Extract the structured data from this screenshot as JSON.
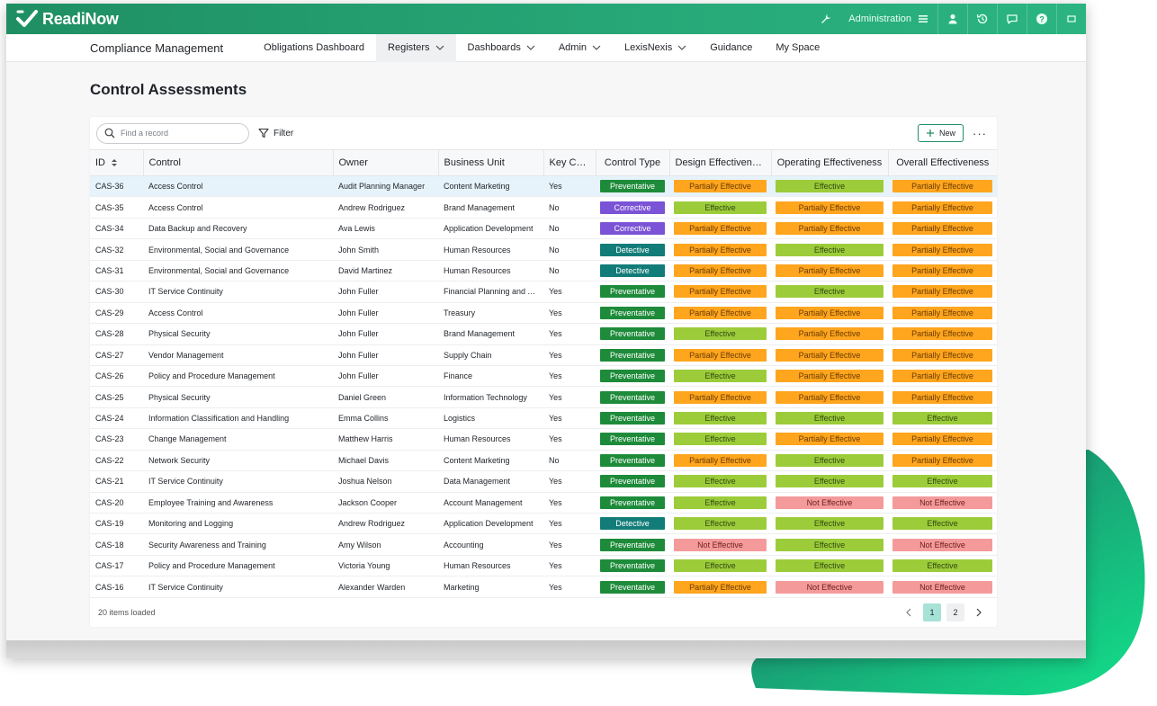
{
  "brand": {
    "name": "ReadiNow",
    "accent": "#27a878"
  },
  "topbar": {
    "administration_label": "Administration",
    "icons": [
      "wrench-icon",
      "hamburger-icon",
      "user-icon",
      "history-icon",
      "chat-icon",
      "help-icon",
      "fullscreen-icon"
    ]
  },
  "nav": {
    "app_title": "Compliance Management",
    "items": [
      {
        "label": "Obligations Dashboard",
        "dropdown": false
      },
      {
        "label": "Registers",
        "dropdown": true,
        "active": true
      },
      {
        "label": "Dashboards",
        "dropdown": true
      },
      {
        "label": "Admin",
        "dropdown": true
      },
      {
        "label": "LexisNexis",
        "dropdown": true
      },
      {
        "label": "Guidance",
        "dropdown": false
      },
      {
        "label": "My Space",
        "dropdown": false
      }
    ]
  },
  "page": {
    "title": "Control Assessments"
  },
  "toolbar": {
    "search_placeholder": "Find a record",
    "filter_label": "Filter",
    "new_label": "New",
    "more_label": "···"
  },
  "table": {
    "columns": [
      "ID",
      "Control",
      "Owner",
      "Business Unit",
      "Key Con...",
      "Control Type",
      "Design Effectiveness",
      "Operating Effectiveness",
      "Overall Effectiveness"
    ],
    "rows": [
      [
        "CAS-36",
        "Access Control",
        "Audit Planning Manager",
        "Content Marketing",
        "Yes",
        "Preventative",
        "Partially Effective",
        "Effective",
        "Partially Effective"
      ],
      [
        "CAS-35",
        "Access Control",
        "Andrew Rodriguez",
        "Brand Management",
        "No",
        "Corrective",
        "Effective",
        "Partially Effective",
        "Partially Effective"
      ],
      [
        "CAS-34",
        "Data Backup and Recovery",
        "Ava Lewis",
        "Application Development",
        "No",
        "Corrective",
        "Partially Effective",
        "Partially Effective",
        "Partially Effective"
      ],
      [
        "CAS-32",
        "Environmental, Social and Governance",
        "John Smith",
        "Human Resources",
        "No",
        "Detective",
        "Partially Effective",
        "Effective",
        "Partially Effective"
      ],
      [
        "CAS-31",
        "Environmental, Social and Governance",
        "David Martinez",
        "Human Resources",
        "No",
        "Detective",
        "Partially Effective",
        "Partially Effective",
        "Partially Effective"
      ],
      [
        "CAS-30",
        "IT Service Continuity",
        "John Fuller",
        "Financial Planning and A...",
        "Yes",
        "Preventative",
        "Partially Effective",
        "Effective",
        "Partially Effective"
      ],
      [
        "CAS-29",
        "Access Control",
        "John Fuller",
        "Treasury",
        "Yes",
        "Preventative",
        "Partially Effective",
        "Partially Effective",
        "Partially Effective"
      ],
      [
        "CAS-28",
        "Physical Security",
        "John Fuller",
        "Brand Management",
        "Yes",
        "Preventative",
        "Effective",
        "Partially Effective",
        "Partially Effective"
      ],
      [
        "CAS-27",
        "Vendor Management",
        "John Fuller",
        "Supply Chain",
        "Yes",
        "Preventative",
        "Partially Effective",
        "Partially Effective",
        "Partially Effective"
      ],
      [
        "CAS-26",
        "Policy and Procedure Management",
        "John Fuller",
        "Finance",
        "Yes",
        "Preventative",
        "Effective",
        "Partially Effective",
        "Partially Effective"
      ],
      [
        "CAS-25",
        "Physical Security",
        "Daniel Green",
        "Information Technology",
        "Yes",
        "Preventative",
        "Partially Effective",
        "Partially Effective",
        "Partially Effective"
      ],
      [
        "CAS-24",
        "Information Classification and Handling",
        "Emma Collins",
        "Logistics",
        "Yes",
        "Preventative",
        "Effective",
        "Effective",
        "Effective"
      ],
      [
        "CAS-23",
        "Change Management",
        "Matthew Harris",
        "Human Resources",
        "Yes",
        "Preventative",
        "Effective",
        "Partially Effective",
        "Partially Effective"
      ],
      [
        "CAS-22",
        "Network Security",
        "Michael Davis",
        "Content Marketing",
        "No",
        "Preventative",
        "Partially Effective",
        "Effective",
        "Partially Effective"
      ],
      [
        "CAS-21",
        "IT Service Continuity",
        "Joshua Nelson",
        "Data Management",
        "Yes",
        "Preventative",
        "Effective",
        "Effective",
        "Effective"
      ],
      [
        "CAS-20",
        "Employee Training and Awareness",
        "Jackson Cooper",
        "Account Management",
        "Yes",
        "Preventative",
        "Effective",
        "Not Effective",
        "Not Effective"
      ],
      [
        "CAS-19",
        "Monitoring and Logging",
        "Andrew Rodriguez",
        "Application Development",
        "Yes",
        "Detective",
        "Effective",
        "Effective",
        "Effective"
      ],
      [
        "CAS-18",
        "Security Awareness and Training",
        "Amy Wilson",
        "Accounting",
        "Yes",
        "Preventative",
        "Not Effective",
        "Effective",
        "Not Effective"
      ],
      [
        "CAS-17",
        "Policy and Procedure Management",
        "Victoria Young",
        "Human Resources",
        "Yes",
        "Preventative",
        "Effective",
        "Effective",
        "Effective"
      ],
      [
        "CAS-16",
        "IT Service Continuity",
        "Alexander Warden",
        "Marketing",
        "Yes",
        "Preventative",
        "Partially Effective",
        "Not Effective",
        "Not Effective"
      ]
    ],
    "selected_row": 0
  },
  "badge_colors": {
    "Preventative": {
      "bg": "#1e8b3a",
      "fg": "#ffffff"
    },
    "Corrective": {
      "bg": "#7a53d6",
      "fg": "#ffffff"
    },
    "Detective": {
      "bg": "#127c78",
      "fg": "#ffffff"
    },
    "Effective": {
      "bg": "#9ccc3a",
      "fg": "#2f4a10"
    },
    "Partially Effective": {
      "bg": "#ffa51e",
      "fg": "#6a3c00"
    },
    "Not Effective": {
      "bg": "#f59a9a",
      "fg": "#6a1f1f"
    }
  },
  "footer": {
    "items_loaded": "20 items loaded",
    "pages": [
      "1",
      "2"
    ],
    "current_page": "1"
  }
}
